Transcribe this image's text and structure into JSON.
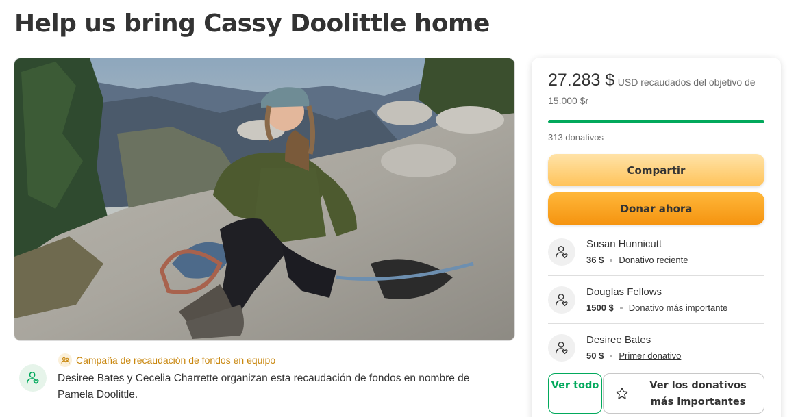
{
  "page": {
    "title": "Help us bring Cassy Doolittle home"
  },
  "hero": {
    "alt": "Photo of Cassy Doolittle sitting on a granite ledge with climbing ropes"
  },
  "organizer": {
    "team_label": "Campaña de recaudación de fondos en equipo",
    "text": "Desiree Bates y Cecelia Charrette organizan esta recaudación de fondos en nombre de Pamela Doolittle."
  },
  "donation_card": {
    "raised_amount": "27.283 $",
    "raised_rest": "USD recaudados del objetivo de 15.000 $r",
    "progress_fraction": 1.0,
    "donations_count": "313 donativos",
    "share_label": "Compartir",
    "donate_label": "Donar ahora",
    "donors": [
      {
        "name": "Susan Hunnicutt",
        "amount": "36 $",
        "tag": "Donativo reciente"
      },
      {
        "name": "Douglas Fellows",
        "amount": "1500 $",
        "tag": "Donativo más importante"
      },
      {
        "name": "Desiree Bates",
        "amount": "50 $",
        "tag": "Primer donativo"
      }
    ],
    "see_all_label": "Ver todo",
    "see_top_label": "Ver los donativos más importantes"
  },
  "colors": {
    "accent_green": "#02a95c",
    "donate_orange": "#f59410",
    "share_yellow": "#ffc35a",
    "team_tag": "#c9870e"
  },
  "icons": [
    "user-heart-icon",
    "team-icon",
    "star-icon"
  ]
}
